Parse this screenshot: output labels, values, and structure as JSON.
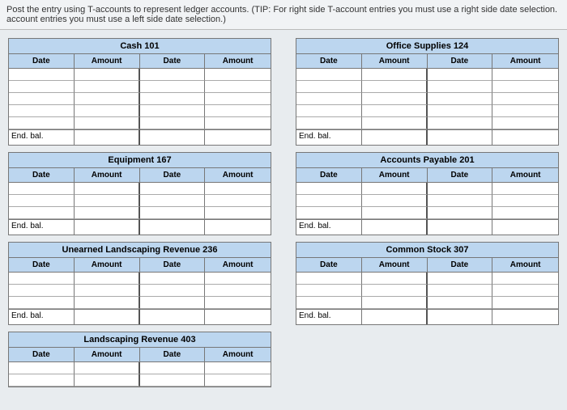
{
  "instructions": "Post the entry using T-accounts to represent ledger accounts. (TIP: For right side T-account entries you must use a right side date selection. account entries you must use a left side date selection.)",
  "headers": {
    "date": "Date",
    "amount": "Amount"
  },
  "end_label": "End. bal.",
  "accounts_left": [
    {
      "title": "Cash 101",
      "rows": 5
    },
    {
      "title": "Equipment 167",
      "rows": 3
    },
    {
      "title": "Unearned Landscaping Revenue 236",
      "rows": 3
    },
    {
      "title": "Landscaping Revenue 403",
      "rows": 2
    }
  ],
  "accounts_right": [
    {
      "title": "Office Supplies 124",
      "rows": 5
    },
    {
      "title": "Accounts Payable 201",
      "rows": 3
    },
    {
      "title": "Common Stock 307",
      "rows": 3
    }
  ]
}
